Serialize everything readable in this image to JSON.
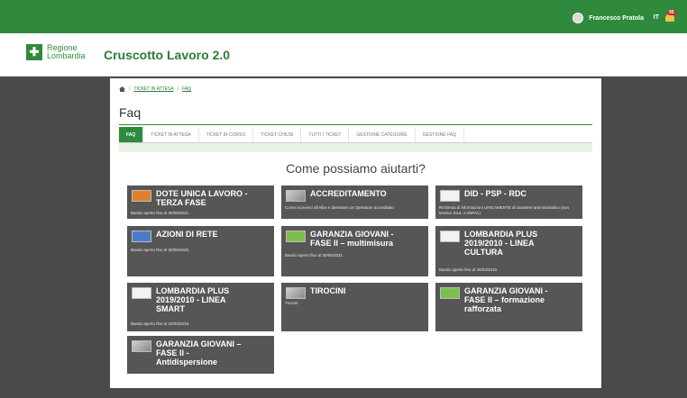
{
  "topbar": {
    "user_name": "Francesco Pratola",
    "lang": "IT",
    "notif_count": "99"
  },
  "brand": {
    "logo_line1": "Regione",
    "logo_line2": "Lombardia",
    "app_title": "Cruscotto Lavoro 2.0"
  },
  "breadcrumb": {
    "sep": "/",
    "crumb1": "TICKET IN ATTESA",
    "crumb2": "FAQ"
  },
  "page": {
    "title": "Faq",
    "hero": "Come possiamo aiutarti?"
  },
  "tabs": [
    {
      "label": "FAQ",
      "active": true
    },
    {
      "label": "TICKET IN ATTESA"
    },
    {
      "label": "TICKET IN CORSO"
    },
    {
      "label": "TICKET CHIUSI"
    },
    {
      "label": "TUTTI I TICKET"
    },
    {
      "label": "GESTIONE CATEGORIE"
    },
    {
      "label": "GESTIONE FAQ"
    }
  ],
  "cards": [
    {
      "title": "DOTE UNICA LAVORO -\nTERZA FASE",
      "subtitle": "Bando aperto fino al 30/09/2021.",
      "icon": "dote-icon"
    },
    {
      "title": "ACCREDITAMENTO",
      "subtitle": "Come iscriversi all'Albo e diventare un Operatore accreditato",
      "icon": "accreditamento-icon"
    },
    {
      "title": "DID - PSP - RDC",
      "subtitle": "Richiesta di informazioni UNICAMENTE di carattere amministrativo (non tecnico SIUL o ANPAL)",
      "icon": "did-icon"
    },
    {
      "title": "AZIONI DI RETE",
      "subtitle": "Bando aperto fino al 30/06/2020.",
      "icon": "azioni-icon"
    },
    {
      "title": "GARANZIA GIOVANI -\nFASE II – multimisura",
      "subtitle": "Bando aperto fino al 30/06/2021.",
      "icon": "garanzia-icon"
    },
    {
      "title": "LOMBARDIA PLUS\n2019/2010 - LINEA\nCULTURA",
      "subtitle": "Bando aperto fino al 26/03/2019.",
      "icon": "lombardia-plus-icon"
    },
    {
      "title": "LOMBARDIA PLUS\n2019/2010 - LINEA\nSMART",
      "subtitle": "Bando aperto fino al 26/03/2019.",
      "icon": "lombardia-smart-icon"
    },
    {
      "title": "TIROCINI",
      "subtitle": "Tirocini",
      "icon": "tirocini-icon"
    },
    {
      "title": "GARANZIA GIOVANI -\nFASE II – formazione\nrafforzata",
      "subtitle": "",
      "icon": "garanzia-formazione-icon"
    },
    {
      "title": "GARANZIA GIOVANI –\nFASE II -\nAntidispersione",
      "subtitle": "",
      "icon": "antidispersione-icon"
    }
  ],
  "colors": {
    "green": "#2f8a3e",
    "card_bg": "#565656",
    "page_bg": "#4a4a4a"
  }
}
